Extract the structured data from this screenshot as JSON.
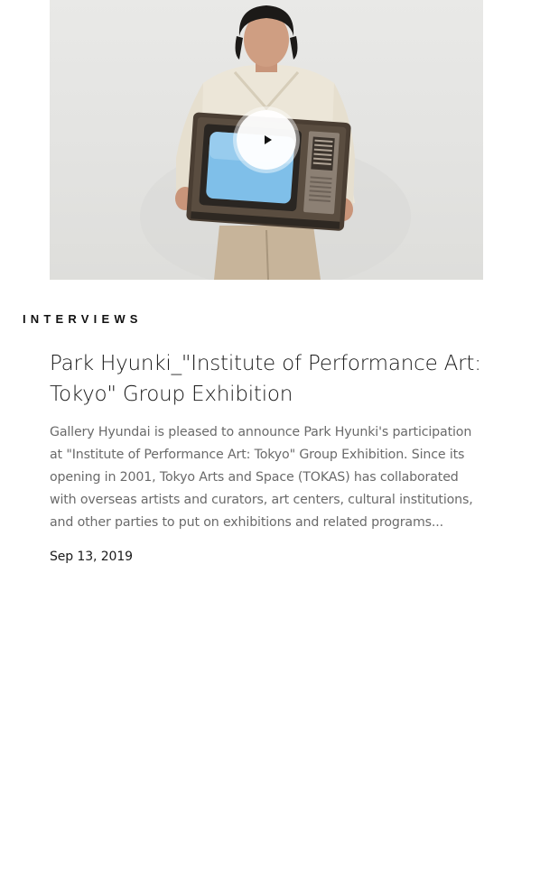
{
  "article": {
    "category": "INTERVIEWS",
    "title": "Park Hyunki_\"Institute of Performance Art: Tokyo\" Group Exhibition",
    "summary": "Gallery Hyundai is pleased to announce Park Hyunki's participation at \"Institute of Performance Art: Tokyo\" Group Exhibition. Since its opening in 2001, Tokyo Arts and Space (TOKAS) has collaborated with overseas artists and curators, art centers, cultural institutions, and other parties to put on exhibitions and related programs...",
    "date": "Sep 13, 2019"
  },
  "media": {
    "play_icon": "play-icon"
  }
}
